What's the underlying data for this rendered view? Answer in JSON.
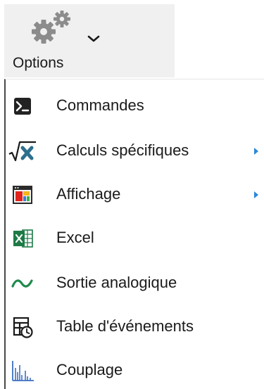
{
  "ribbon": {
    "button_label": "Options",
    "icon": "gears-icon",
    "dropdown_icon": "chevron-down-icon"
  },
  "menu": {
    "items": [
      {
        "label": "Commandes",
        "icon": "command-prompt-icon",
        "has_submenu": false
      },
      {
        "label": "Calculs spécifiques",
        "icon": "square-root-icon",
        "has_submenu": true
      },
      {
        "label": "Affichage",
        "icon": "display-window-icon",
        "has_submenu": true
      },
      {
        "label": "Excel",
        "icon": "excel-icon",
        "has_submenu": false
      },
      {
        "label": "Sortie analogique",
        "icon": "analog-wave-icon",
        "has_submenu": false
      },
      {
        "label": "Table d'événements",
        "icon": "event-table-icon",
        "has_submenu": false
      },
      {
        "label": "Couplage",
        "icon": "coupling-chart-icon",
        "has_submenu": false
      }
    ]
  },
  "colors": {
    "ribbon_background": "#f0f0f0",
    "submenu_arrow": "#2b88d8",
    "excel_green": "#1d7a45",
    "wave_green": "#1f8a4c"
  }
}
